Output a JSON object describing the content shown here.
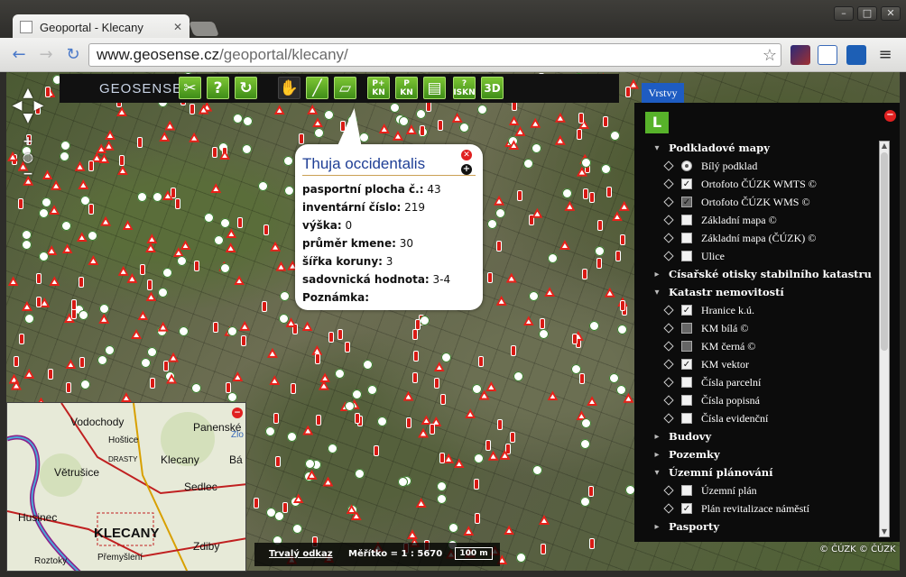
{
  "browser": {
    "tab_title": "Geoportal - Klecany",
    "url_host": "www.geosense.cz",
    "url_path": "/geoportal/klecany/"
  },
  "toolbar": {
    "logo": "GEOSENSE",
    "tools": [
      {
        "name": "tools-icon",
        "label": ""
      },
      {
        "name": "help-icon",
        "label": "?"
      },
      {
        "name": "refresh-icon",
        "label": ""
      },
      {
        "name": "pan-hand-icon",
        "label": ""
      },
      {
        "name": "measure-length-icon",
        "label": ""
      },
      {
        "name": "measure-area-icon",
        "label": ""
      },
      {
        "name": "parcel-info-plus",
        "label": "P+ KN"
      },
      {
        "name": "parcel-info",
        "label": "P KN"
      },
      {
        "name": "print-icon",
        "label": ""
      },
      {
        "name": "iskn-button",
        "label": "? ISKN"
      },
      {
        "name": "3d-button",
        "label": "3D"
      }
    ]
  },
  "popup": {
    "title": "Thuja occidentalis",
    "rows": [
      {
        "key": "pasportní plocha č.:",
        "value": "43"
      },
      {
        "key": "inventární číslo:",
        "value": "219"
      },
      {
        "key": "výška:",
        "value": "0"
      },
      {
        "key": "průměr kmene:",
        "value": "30"
      },
      {
        "key": "šířka koruny:",
        "value": "3"
      },
      {
        "key": "sadovnická hodnota:",
        "value": "3-4"
      },
      {
        "key": "Poznámka:",
        "value": ""
      }
    ]
  },
  "overview_map": {
    "labels": [
      "Husinec",
      "KLECANY",
      "Klecany",
      "Vodochody",
      "Hoštice",
      "Větrušice",
      "Sedlec",
      "Panenské",
      "Zdiby",
      "Přemyšlení",
      "Roztoky",
      "DRASTY",
      "Bá",
      "Zlo"
    ]
  },
  "scalebar": {
    "link": "Trvalý odkaz",
    "scale": "Měřítko = 1 : 5670",
    "bar": "100 m"
  },
  "copyright": "© ČÚZK © ČÚZK",
  "layers_panel": {
    "button": "Vrstvy",
    "items": [
      {
        "type": "group",
        "label": "Podkladové mapy",
        "expanded": true
      },
      {
        "type": "radio",
        "label": "Bílý podklad",
        "checked": true,
        "eye": true
      },
      {
        "type": "check",
        "label": "Ortofoto ČÚZK WMTS ©",
        "checked": true,
        "eye": true
      },
      {
        "type": "check",
        "label": "Ortofoto ČÚZK WMS ©",
        "checked": true,
        "disabled": true,
        "eye": true
      },
      {
        "type": "check",
        "label": "Základní mapa ©",
        "checked": false,
        "eye": true
      },
      {
        "type": "check",
        "label": "Základní mapa (ČÚZK) ©",
        "checked": false,
        "eye": true
      },
      {
        "type": "check",
        "label": "Ulice",
        "checked": false,
        "eye": true
      },
      {
        "type": "group",
        "label": "Císařské otisky stabilního katastru",
        "expanded": false
      },
      {
        "type": "group",
        "label": "Katastr nemovitostí",
        "expanded": true
      },
      {
        "type": "check",
        "label": "Hranice k.ú.",
        "checked": true,
        "eye": true
      },
      {
        "type": "check",
        "label": "KM bílá ©",
        "checked": false,
        "disabled": true,
        "eye": true
      },
      {
        "type": "check",
        "label": "KM černá ©",
        "checked": false,
        "disabled": true,
        "eye": true
      },
      {
        "type": "check",
        "label": "KM vektor",
        "checked": true,
        "eye": true
      },
      {
        "type": "check",
        "label": "Čísla parcelní",
        "checked": false,
        "eye": true
      },
      {
        "type": "check",
        "label": "Čísla popisná",
        "checked": false,
        "eye": true
      },
      {
        "type": "check",
        "label": "Čísla evidenční",
        "checked": false,
        "eye": true
      },
      {
        "type": "group",
        "label": "Budovy",
        "expanded": false
      },
      {
        "type": "group",
        "label": "Pozemky",
        "expanded": false
      },
      {
        "type": "group",
        "label": "Územní plánování",
        "expanded": true
      },
      {
        "type": "check",
        "label": "Územní plán",
        "checked": false,
        "folder": true
      },
      {
        "type": "check",
        "label": "Plán revitalizace náměstí",
        "checked": true,
        "folder": true
      },
      {
        "type": "group",
        "label": "Pasporty",
        "expanded": false
      }
    ]
  }
}
